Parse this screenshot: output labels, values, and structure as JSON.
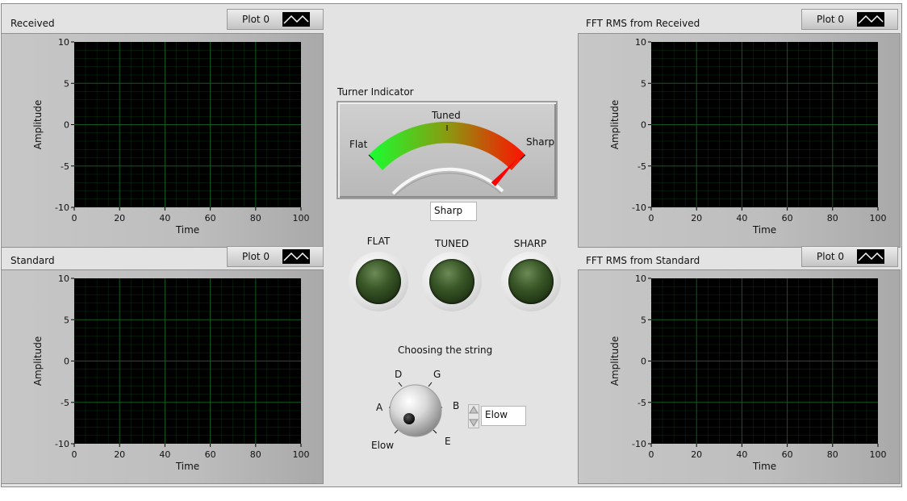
{
  "graphs": {
    "received": {
      "title": "Received",
      "plot_label": "Plot 0",
      "ylabel": "Amplitude",
      "xlabel": "Time",
      "yticks": [
        "10",
        "5",
        "0",
        "-5",
        "-10"
      ],
      "xticks": [
        "0",
        "20",
        "40",
        "60",
        "80",
        "100"
      ]
    },
    "standard": {
      "title": "Standard",
      "plot_label": "Plot 0",
      "ylabel": "Amplitude",
      "xlabel": "Time",
      "yticks": [
        "10",
        "5",
        "0",
        "-5",
        "-10"
      ],
      "xticks": [
        "0",
        "20",
        "40",
        "60",
        "80",
        "100"
      ]
    },
    "fft_received": {
      "title": "FFT RMS from Received",
      "plot_label": "Plot 0",
      "ylabel": "Amplitude",
      "xlabel": "Time",
      "yticks": [
        "10",
        "5",
        "0",
        "-5",
        "-10"
      ],
      "xticks": [
        "0",
        "20",
        "40",
        "60",
        "80",
        "100"
      ]
    },
    "fft_standard": {
      "title": "FFT RMS from Standard",
      "plot_label": "Plot 0",
      "ylabel": "Amplitude",
      "xlabel": "Time",
      "yticks": [
        "10",
        "5",
        "0",
        "-5",
        "-10"
      ],
      "xticks": [
        "0",
        "20",
        "40",
        "60",
        "80",
        "100"
      ]
    }
  },
  "tuner": {
    "label": "Turner Indicator",
    "scale_flat": "Flat",
    "scale_tuned": "Tuned",
    "scale_sharp": "Sharp",
    "value_text": "Sharp",
    "needle_fraction": 1.0
  },
  "leds": {
    "flat": "FLAT",
    "tuned": "TUNED",
    "sharp": "SHARP"
  },
  "string_selector": {
    "label": "Choosing the string",
    "positions": [
      "Elow",
      "A",
      "D",
      "G",
      "B",
      "E"
    ],
    "selected": "Elow"
  },
  "colors": {
    "plot_bg": "#000000",
    "grid": "#0f5a1e",
    "led_off": "#2f4a22",
    "needle": "#ff0000",
    "meter_left": "#18ff30",
    "meter_right": "#ff1000"
  }
}
